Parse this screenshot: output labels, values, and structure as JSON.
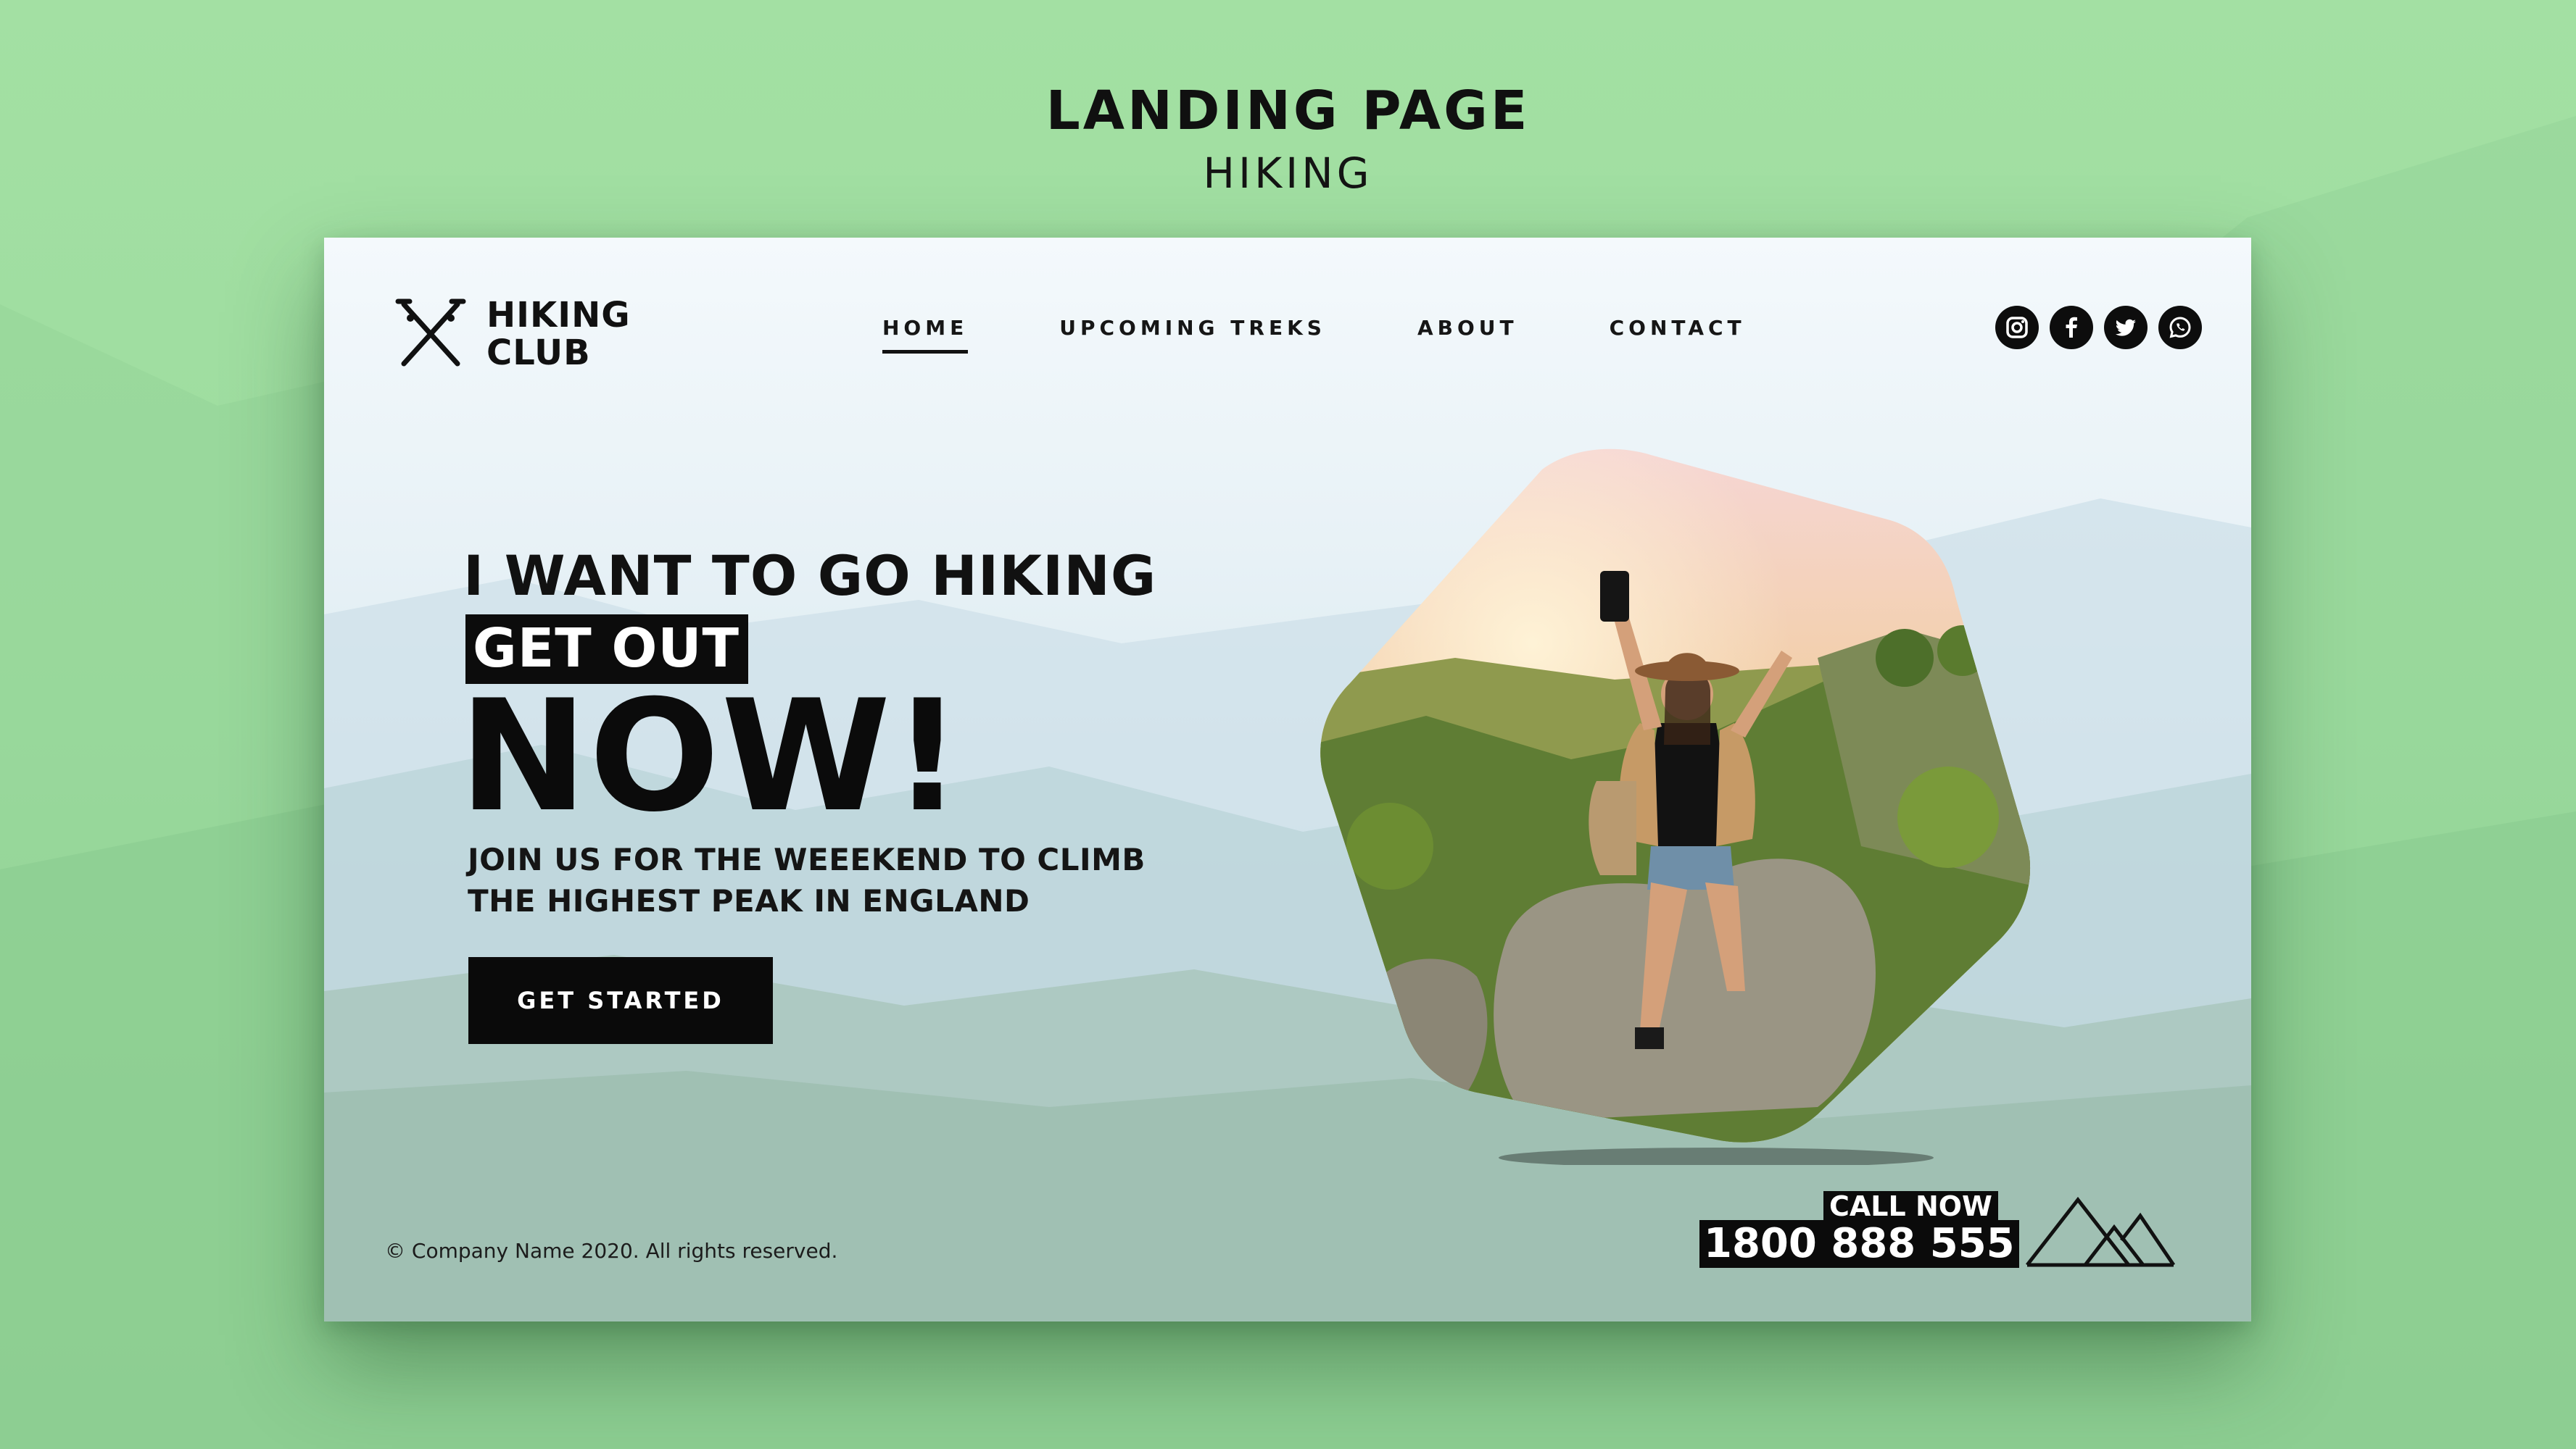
{
  "showcase": {
    "title": "LANDING PAGE",
    "subtitle": "HIKING"
  },
  "brand": {
    "line1": "HIKING",
    "line2": "CLUB",
    "logo_icon": "crossed-trekking-poles-icon"
  },
  "nav": {
    "items": [
      {
        "label": "HOME",
        "active": true
      },
      {
        "label": "UPCOMING TREKS",
        "active": false
      },
      {
        "label": "ABOUT",
        "active": false
      },
      {
        "label": "CONTACT",
        "active": false
      }
    ]
  },
  "social": [
    {
      "icon": "instagram-icon"
    },
    {
      "icon": "facebook-icon"
    },
    {
      "icon": "twitter-icon"
    },
    {
      "icon": "whatsapp-icon"
    }
  ],
  "hero": {
    "headline": "I WANT TO GO HIKING",
    "highlight": "GET OUT",
    "big_word": "NOW!",
    "subtext_line1": "JOIN US FOR THE WEEEKEND TO CLIMB",
    "subtext_line2": "THE HIGHEST PEAK IN ENGLAND",
    "cta_label": "GET STARTED",
    "photo_icon": "hiker-photo"
  },
  "footer": {
    "copyright": "© Company Name 2020. All rights reserved.",
    "call_label": "CALL NOW",
    "phone": "1800 888 555",
    "mountain_icon": "mountains-icon"
  },
  "colors": {
    "background": "#a3e0a3",
    "text": "#111111",
    "button": "#0a0a0a",
    "button_text": "#ffffff"
  }
}
